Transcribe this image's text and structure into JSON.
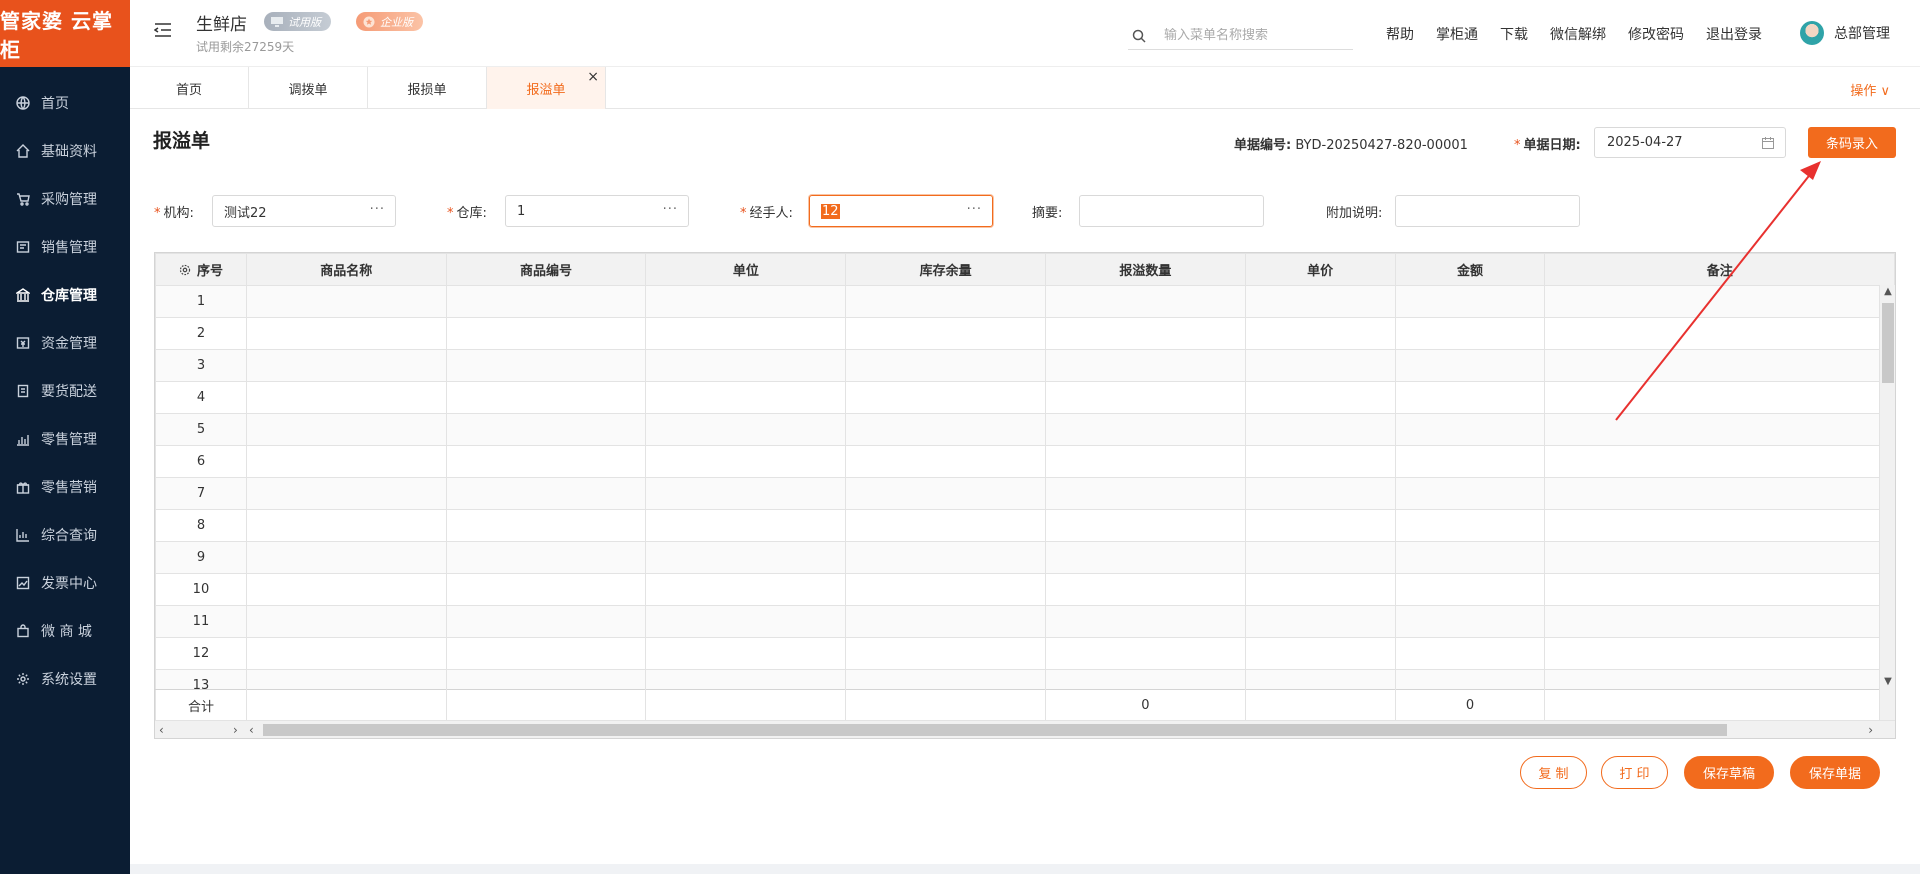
{
  "brand": {
    "logo_text": "管家婆 云掌柜"
  },
  "sidebar": {
    "items": [
      {
        "label": "首页",
        "icon": "globe-icon"
      },
      {
        "label": "基础资料",
        "icon": "home-icon"
      },
      {
        "label": "采购管理",
        "icon": "cart-icon"
      },
      {
        "label": "销售管理",
        "icon": "receipt-icon"
      },
      {
        "label": "仓库管理",
        "icon": "warehouse-icon"
      },
      {
        "label": "资金管理",
        "icon": "money-icon"
      },
      {
        "label": "要货配送",
        "icon": "clipboard-icon"
      },
      {
        "label": "零售管理",
        "icon": "bar-chart-icon"
      },
      {
        "label": "零售营销",
        "icon": "gift-icon"
      },
      {
        "label": "综合查询",
        "icon": "chart-icon"
      },
      {
        "label": "发票中心",
        "icon": "trend-icon"
      },
      {
        "label": "微 商 城",
        "icon": "bag-icon"
      },
      {
        "label": "系统设置",
        "icon": "gear-icon"
      }
    ],
    "active_index": 4
  },
  "header": {
    "store_name": "生鲜店",
    "badge_trial": "试用版",
    "badge_enterprise": "企业版",
    "trial_days": "试用剩余27259天",
    "search_placeholder": "输入菜单名称搜索",
    "links": [
      "帮助",
      "掌柜通",
      "下载",
      "微信解绑",
      "修改密码",
      "退出登录"
    ],
    "user_name": "总部管理"
  },
  "tabs": {
    "items": [
      "首页",
      "调拨单",
      "报损单",
      "报溢单"
    ],
    "active_index": 3,
    "close_symbol": "×",
    "ops_label": "操作 ∨"
  },
  "form": {
    "title": "报溢单",
    "doc_no_label": "单据编号:",
    "doc_no_value": "BYD-20250427-820-00001",
    "date_label": "单据日期:",
    "date_value": "2025-04-27",
    "barcode_button": "条码录入",
    "org_label": "机构:",
    "org_value": "测试22",
    "warehouse_label": "仓库:",
    "warehouse_value": "1",
    "handler_label": "经手人:",
    "handler_value": "12",
    "summary_label": "摘要:",
    "summary_value": "",
    "note_label": "附加说明:",
    "note_value": "",
    "dots": "···",
    "required_mark": "*"
  },
  "table": {
    "columns": [
      "序号",
      "商品名称",
      "商品编号",
      "单位",
      "库存余量",
      "报溢数量",
      "单价",
      "金额",
      "备注"
    ],
    "rows": [
      "1",
      "2",
      "3",
      "4",
      "5",
      "6",
      "7",
      "8",
      "9",
      "10",
      "11",
      "12",
      "13"
    ],
    "footer": {
      "label": "合计",
      "qty_total": "0",
      "amount_total": "0"
    }
  },
  "actions": {
    "copy": "复 制",
    "print": "打 印",
    "save_draft": "保存草稿",
    "save_doc": "保存单据"
  },
  "colors": {
    "accent": "#f26b1d",
    "sidebar_bg": "#0b1d33",
    "arrow": "#e8312f"
  }
}
